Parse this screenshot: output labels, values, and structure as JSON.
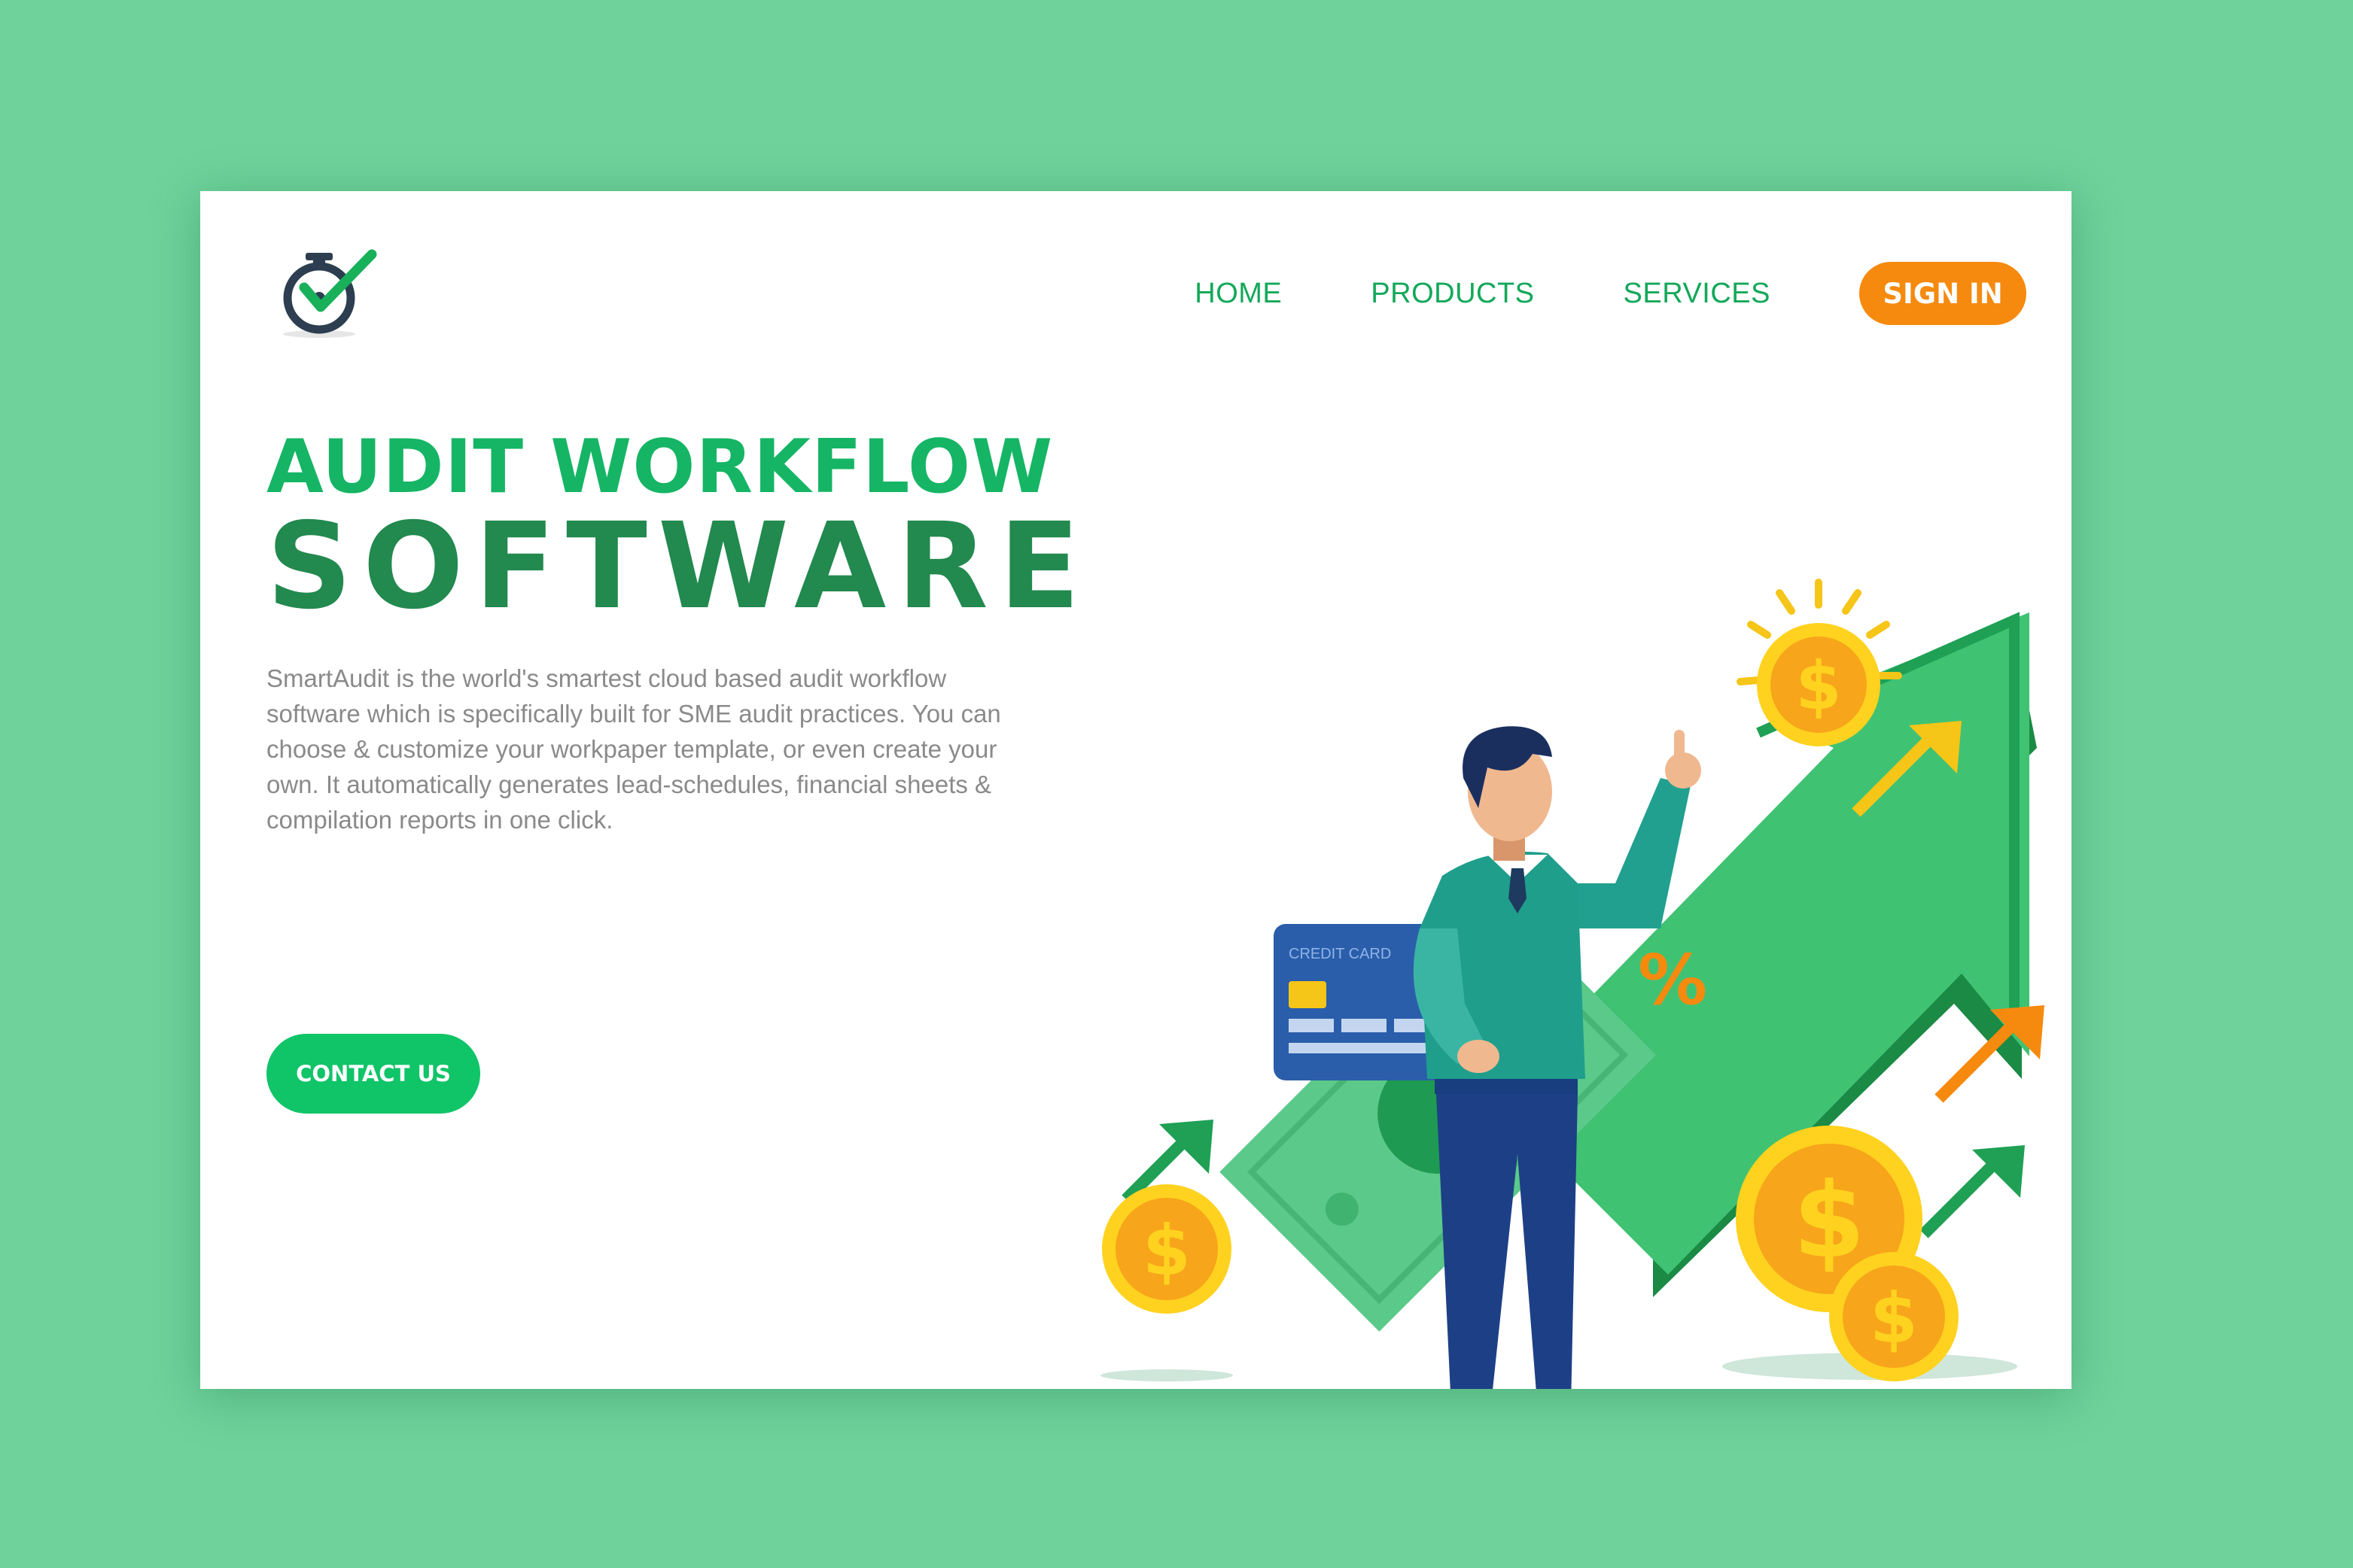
{
  "brand": {
    "logo_icon": "stopwatch-check-icon"
  },
  "nav": {
    "items": [
      {
        "label": "HOME"
      },
      {
        "label": "PRODUCTS"
      },
      {
        "label": "SERVICES"
      }
    ],
    "signin_label": "SIGN IN"
  },
  "hero": {
    "title_line1": "AUDIT WORKFLOW",
    "title_line2": "SOFTWARE",
    "description": "SmartAudit is the world's smartest cloud based audit workflow software which is specifically built for SME audit practices. You can choose & customize your workpaper template, or even create your own. It automatically generates lead-schedules, financial sheets & compilation reports in one click.",
    "cta_label": "CONTACT US"
  },
  "illustration": {
    "card_label": "CREDIT CARD",
    "percent_symbol": "%",
    "coin_symbol": "$"
  },
  "colors": {
    "background": "#6ed29a",
    "primary_green": "#15b565",
    "dark_green": "#22894f",
    "accent_orange": "#f58a0f",
    "body_text": "#8a8a8a"
  }
}
